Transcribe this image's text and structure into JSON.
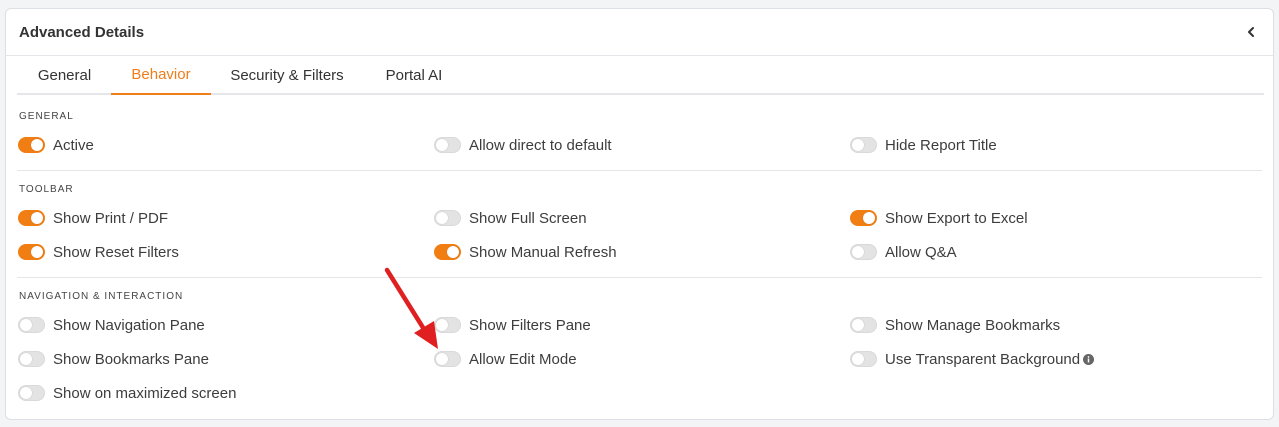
{
  "panel": {
    "title": "Advanced Details"
  },
  "tabs": [
    {
      "label": "General",
      "active": false
    },
    {
      "label": "Behavior",
      "active": true
    },
    {
      "label": "Security & Filters",
      "active": false
    },
    {
      "label": "Portal AI",
      "active": false
    }
  ],
  "sections": {
    "general": {
      "label": "GENERAL",
      "options": [
        {
          "label": "Active",
          "on": true
        },
        {
          "label": "Allow direct to default",
          "on": false
        },
        {
          "label": "Hide Report Title",
          "on": false
        }
      ]
    },
    "toolbar": {
      "label": "TOOLBAR",
      "options": [
        {
          "label": "Show Print / PDF",
          "on": true
        },
        {
          "label": "Show Full Screen",
          "on": false
        },
        {
          "label": "Show Export to Excel",
          "on": true
        },
        {
          "label": "Show Reset Filters",
          "on": true
        },
        {
          "label": "Show Manual Refresh",
          "on": true
        },
        {
          "label": "Allow Q&A",
          "on": false
        }
      ]
    },
    "navigation": {
      "label": "NAVIGATION & INTERACTION",
      "options": [
        {
          "label": "Show Navigation Pane",
          "on": false
        },
        {
          "label": "Show Filters Pane",
          "on": false
        },
        {
          "label": "Show Manage Bookmarks",
          "on": false
        },
        {
          "label": "Show Bookmarks Pane",
          "on": false
        },
        {
          "label": "Allow Edit Mode",
          "on": false
        },
        {
          "label": "Use Transparent Background",
          "on": false
        },
        {
          "label": "Show on maximized screen",
          "on": false
        }
      ]
    }
  },
  "colors": {
    "accent": "#ef7d1a",
    "arrow": "#e02020",
    "toggle_off": "#e3e3e3"
  },
  "icons": {
    "collapse": "chevron-left-icon",
    "info": "info-icon"
  }
}
